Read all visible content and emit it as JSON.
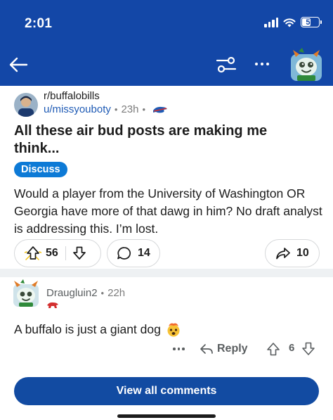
{
  "status_bar": {
    "time": "2:01",
    "battery": "52",
    "battery_level": 0.52,
    "icons": [
      "signal-icon",
      "wifi-icon",
      "battery-icon"
    ]
  },
  "nav": {
    "icons": [
      "back-arrow-icon",
      "sliders-icon",
      "more-icon",
      "profile-avatar"
    ],
    "header_color": "#1347a7"
  },
  "post": {
    "subreddit": "r/buffalobills",
    "author": "u/missyouboty",
    "separator": "•",
    "time_ago": "23h",
    "flair_icon": "bills-logo-icon",
    "title": "All these air bud posts are making me think...",
    "flair_chip": "Discuss",
    "body": "Would a player from the University of Washington OR Georgia have more of that dawg in him? No draft analyst is addressing this. I’m lost.",
    "upvotes": "56",
    "comments": "14",
    "shares": "10",
    "accent_color": "#0d7ad6"
  },
  "comment": {
    "author": "Draugluin2",
    "separator": "•",
    "time_ago": "22h",
    "flair_icon": "red-buffalo-icon",
    "body": "A buffalo is just a giant dog",
    "emoji": "exploding-head-emoji",
    "reply_label": "Reply",
    "votes": "6"
  },
  "footer": {
    "view_all_label": "View all comments",
    "button_color": "#124ba2"
  }
}
